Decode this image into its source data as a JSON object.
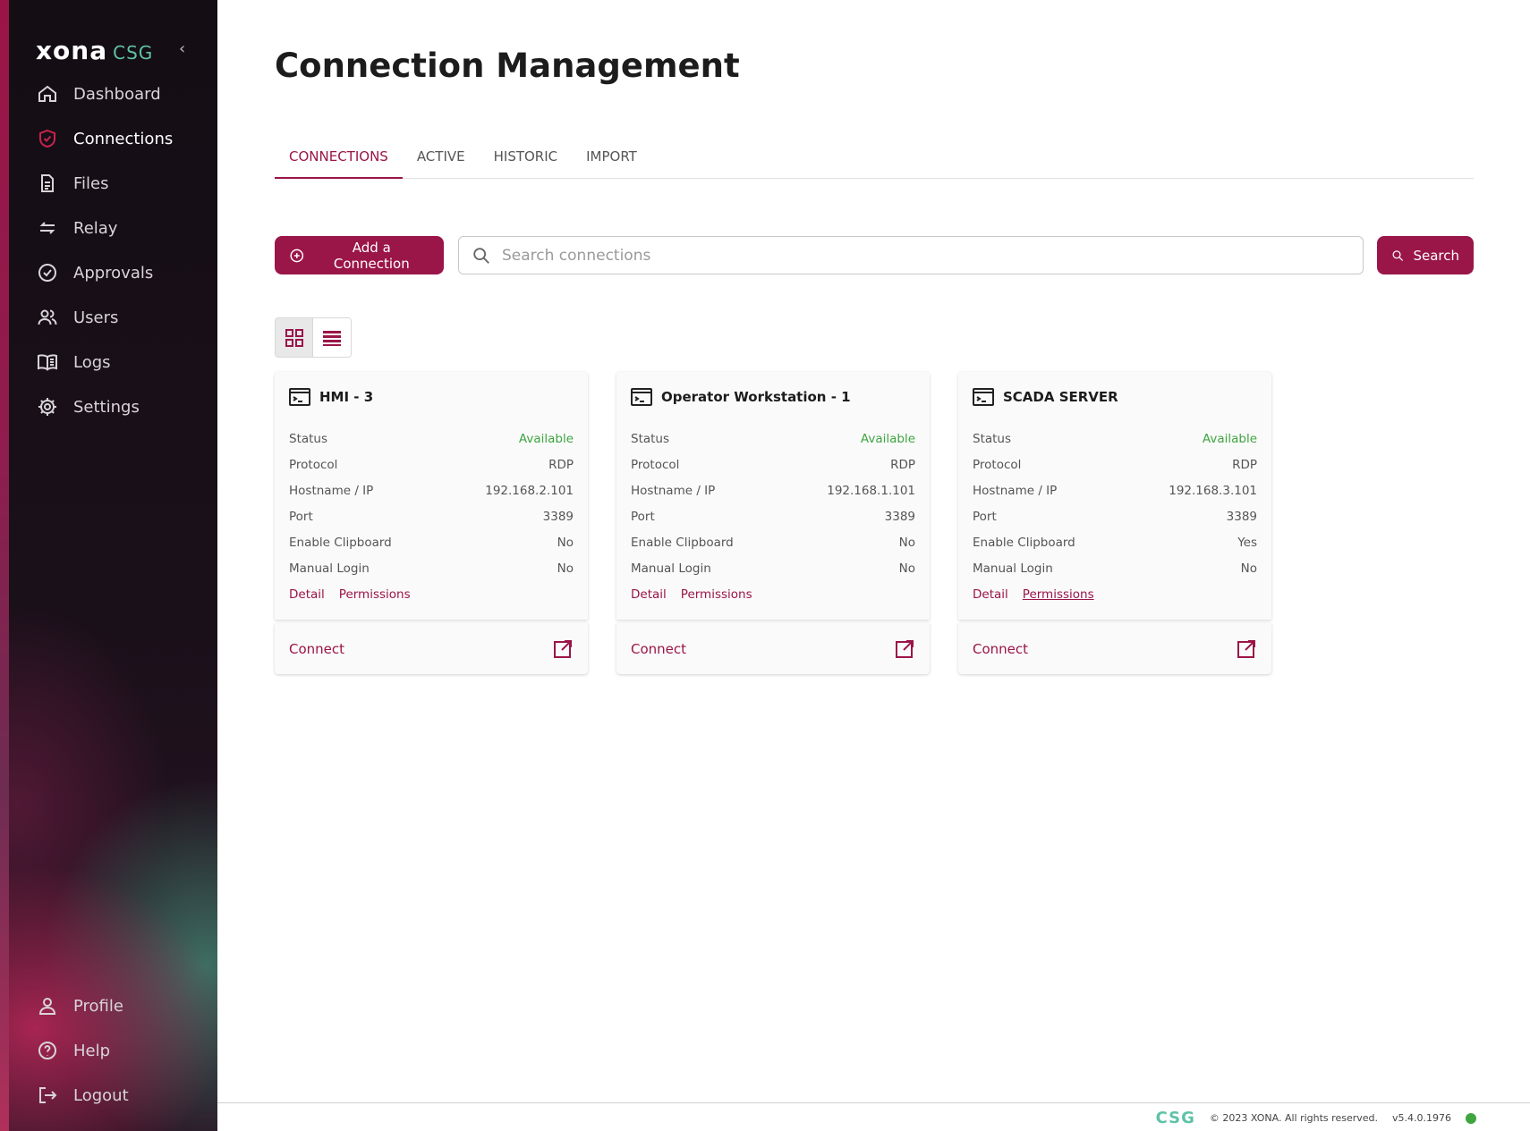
{
  "brand": {
    "name": "xona",
    "sub": "CSG"
  },
  "sidebar": {
    "items": [
      {
        "label": "Dashboard",
        "icon": "home-icon"
      },
      {
        "label": "Connections",
        "icon": "shield-check-icon",
        "active": true
      },
      {
        "label": "Files",
        "icon": "file-icon"
      },
      {
        "label": "Relay",
        "icon": "arrows-swap-icon"
      },
      {
        "label": "Approvals",
        "icon": "check-circle-icon"
      },
      {
        "label": "Users",
        "icon": "users-icon"
      },
      {
        "label": "Logs",
        "icon": "book-icon"
      },
      {
        "label": "Settings",
        "icon": "gear-icon"
      }
    ],
    "bottom": [
      {
        "label": "Profile",
        "icon": "user-icon"
      },
      {
        "label": "Help",
        "icon": "help-circle-icon"
      },
      {
        "label": "Logout",
        "icon": "logout-icon"
      }
    ]
  },
  "page": {
    "title": "Connection Management"
  },
  "tabs": [
    {
      "label": "CONNECTIONS",
      "active": true
    },
    {
      "label": "ACTIVE"
    },
    {
      "label": "HISTORIC"
    },
    {
      "label": "IMPORT"
    }
  ],
  "toolbar": {
    "add_label": "Add a Connection",
    "search_placeholder": "Search connections",
    "search_value": "",
    "search_label": "Search"
  },
  "fields": {
    "status": "Status",
    "protocol": "Protocol",
    "host": "Hostname / IP",
    "port": "Port",
    "clipboard": "Enable Clipboard",
    "manual": "Manual Login",
    "detail": "Detail",
    "permissions": "Permissions",
    "connect": "Connect"
  },
  "cards": [
    {
      "title": "HMI - 3",
      "status": "Available",
      "protocol": "RDP",
      "host": "192.168.2.101",
      "port": "3389",
      "clipboard": "No",
      "manual": "No"
    },
    {
      "title": "Operator Workstation - 1",
      "status": "Available",
      "protocol": "RDP",
      "host": "192.168.1.101",
      "port": "3389",
      "clipboard": "No",
      "manual": "No"
    },
    {
      "title": "SCADA SERVER",
      "status": "Available",
      "protocol": "RDP",
      "host": "192.168.3.101",
      "port": "3389",
      "clipboard": "Yes",
      "manual": "No"
    }
  ],
  "footer": {
    "logo": "CSG",
    "copyright": "© 2023 XONA. All rights reserved.",
    "version": "v5.4.0.1976"
  },
  "colors": {
    "accent": "#9a1548",
    "success": "#3ea540",
    "brand_teal": "#5fc2a6"
  }
}
